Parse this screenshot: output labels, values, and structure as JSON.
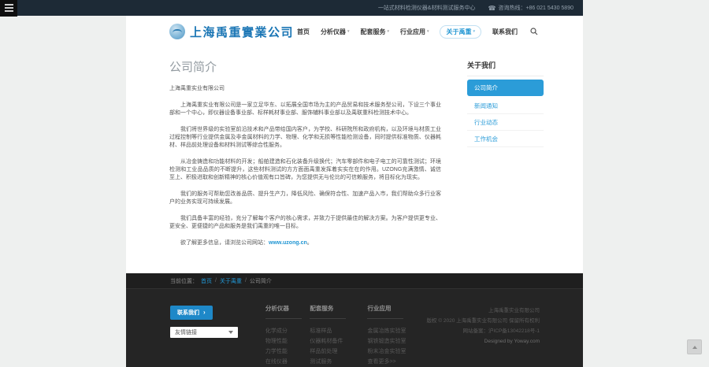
{
  "topbar": {
    "tagline": "一站式材料检测仪器&材料测试服务中心",
    "hotline": "咨询热线：+86 021 5430 5890"
  },
  "header": {
    "company_name": "上海禹重實業公司",
    "nav": [
      {
        "label": "首页"
      },
      {
        "label": "分析仪器"
      },
      {
        "label": "配套服务"
      },
      {
        "label": "行业应用"
      },
      {
        "label": "关于禹重"
      },
      {
        "label": "联系我们"
      }
    ]
  },
  "main": {
    "title": "公司简介",
    "paragraphs": [
      "上海禹重实业有限公司",
      "上海禹重实业有限公司是一家立足华东、以拓展全国市场为主的产品贸易和技术服务型公司，下设三个事业部和一个中心，即仪器设备事业部、标样耗材事业部、服饰辅料事业部以及禹联重科检测技术中心。",
      "我们将世界级的实验室前沿技术和产品带给国内客户，为学校、科研院所和政府机构，以及环境与材质工业过程控制等行业提供金属及非金属材料的力学、物理、化学和无损等性能检测设备，同时提供标准物质、仪器耗材、样品前处理设备和材料测试等综合性服务。",
      "从冶金铸造和功能材料的开发；船舶建造和石化装备升级换代；汽车零部件和电子电工的可靠性测试；环境检测和工业品品质的不断提升，这些材料测试的方方面面禹重发挥着实实在在的作用。UZONG充满激情、诚信至上、积极进取和创新精神的核心价值观有口皆碑，为您提供无与伦比的可信赖服务，将目标化为现实。",
      "我们的服务可帮助您改善品质、提升生产力，降低风险、确保符合性、加速产品入市，我们帮助众多行业客户的业务实现可持续发展。",
      "我们具备丰富的经验，充分了解每个客户的核心需求，并致力于提供最佳的解决方案。为客户提供更专业、更安全、更便捷的产品和服务是我们禹重的唯一目标。"
    ],
    "more_info_prefix": "欲了解更多信息，请浏览公司网站：",
    "website": "www.uzong.cn",
    "more_info_suffix": "。"
  },
  "sidebar": {
    "title": "关于我们",
    "items": [
      {
        "label": "公司简介"
      },
      {
        "label": "新闻通知"
      },
      {
        "label": "行业动态"
      },
      {
        "label": "工作机会"
      }
    ]
  },
  "breadcrumb": {
    "prefix": "当前位置：",
    "link1": "首页",
    "link2": "关于禹重",
    "current": "公司简介",
    "separator": "/"
  },
  "footer": {
    "contact_button": "联系我们",
    "links_select": "友情链接",
    "columns": [
      {
        "title": "分析仪器",
        "links": [
          "化学成分",
          "物理性能",
          "力学性能",
          "在线仪器"
        ]
      },
      {
        "title": "配套服务",
        "links": [
          "标准样品",
          "仪器耗材备件",
          "样品前处理",
          "测试服务"
        ]
      },
      {
        "title": "行业应用",
        "links": [
          "金属冶炼实验室",
          "钢铁锻造实验室",
          "粉末冶金实验室",
          "查看更多>>"
        ]
      }
    ],
    "copyright": [
      "上海禹重实业有限公司",
      "版权 © 2020 上海禹重实业有限公司 保留所有权利",
      "网站备案：沪ICP备13042218号-1",
      "Designed by Yoway.com"
    ]
  },
  "icons": {
    "phone": "☎",
    "chevron_down": "▾",
    "arrow_right": "›"
  },
  "colors": {
    "accent": "#2196d3",
    "topbar_bg": "#1d2a36",
    "footer_bg": "#252525"
  }
}
